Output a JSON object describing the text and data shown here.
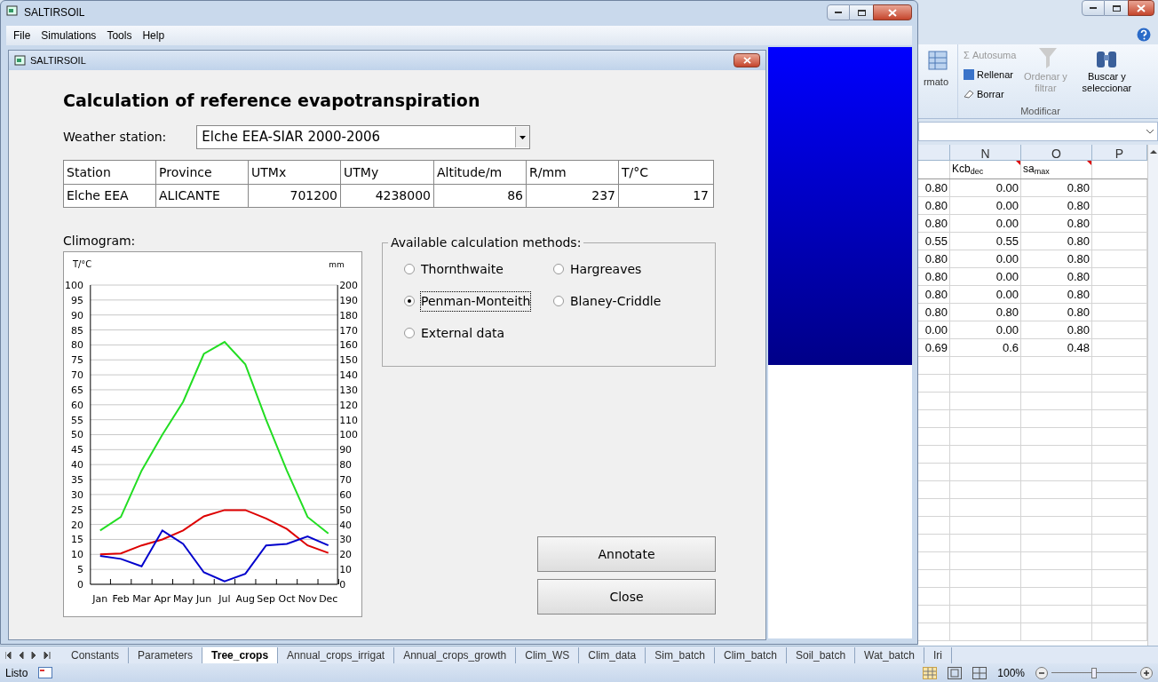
{
  "app_window": {
    "title": "SALTIRSOIL",
    "menu": [
      "File",
      "Simulations",
      "Tools",
      "Help"
    ]
  },
  "dialog": {
    "title": "SALTIRSOIL",
    "heading": "Calculation of reference evapotranspiration",
    "station_label": "Weather station:",
    "station_value": "Elche EEA-SIAR 2000-2006",
    "table": {
      "columns": [
        "Station",
        "Province",
        "UTMx",
        "UTMy",
        "Altitude/m",
        "R/mm",
        "T/°C"
      ],
      "rows": [
        [
          "Elche EEA",
          "ALICANTE",
          "701200",
          "4238000",
          "86",
          "237",
          "17"
        ]
      ]
    },
    "climogram_label": "Climogram:",
    "chart": {
      "chart_data": {
        "type": "line",
        "ylabel": "T/°C",
        "y2label": "mm",
        "categories": [
          "Jan",
          "Feb",
          "Mar",
          "Apr",
          "May",
          "Jun",
          "Jul",
          "Aug",
          "Sep",
          "Oct",
          "Nov",
          "Dec"
        ],
        "ylim": [
          0,
          100
        ],
        "grid": true,
        "yticks": [
          0,
          5,
          10,
          15,
          20,
          25,
          30,
          35,
          40,
          45,
          50,
          55,
          60,
          65,
          70,
          75,
          80,
          85,
          90,
          95,
          100
        ],
        "y2ticks": [
          "0",
          "10",
          "20",
          "30",
          "40",
          "50",
          "60",
          "70",
          "80",
          "90",
          "100",
          "110",
          "120",
          "130",
          "140",
          "150",
          "160",
          "170",
          "180",
          "190",
          "200"
        ],
        "series": [
          {
            "color": "#22dd22",
            "values": [
              18,
              22.5,
              38,
              50,
              61,
              77,
              81,
              73.5,
              55,
              38,
              22.5,
              17
            ]
          },
          {
            "color": "#dd0000",
            "values": [
              10,
              10.3,
              13,
              15,
              18,
              22.7,
              24.8,
              24.8,
              22,
              18.5,
              13,
              10.5
            ]
          },
          {
            "color": "#0000cc",
            "values": [
              9.5,
              8.5,
              6,
              18,
              13.5,
              4,
              1,
              3.5,
              13,
              13.5,
              16,
              13
            ]
          }
        ]
      }
    },
    "methods_title": "Available calculation methods:",
    "methods": [
      {
        "label": "Thornthwaite",
        "selected": false
      },
      {
        "label": "Hargreaves",
        "selected": false
      },
      {
        "label": "Penman-Monteith",
        "selected": true
      },
      {
        "label": "Blaney-Criddle",
        "selected": false
      },
      {
        "label": "External data",
        "selected": false
      }
    ],
    "buttons": [
      "Annotate",
      "Close"
    ]
  },
  "excel": {
    "ribbon": {
      "partial": "rmato",
      "autosuma_icon": "Σ",
      "autosuma": "Autosuma",
      "rellenar": "Rellenar",
      "borrar": "Borrar",
      "ordenar": "Ordenar y filtrar",
      "buscar": "Buscar y seleccionar",
      "group": "Modificar"
    },
    "columns": [
      "N",
      "O",
      "P"
    ],
    "header_row": [
      "Kcb$_{dec}$",
      "sa$_{max}$"
    ],
    "rows": [
      [
        "0.80",
        "0.00",
        "0.80"
      ],
      [
        "0.80",
        "0.00",
        "0.80"
      ],
      [
        "0.80",
        "0.00",
        "0.80"
      ],
      [
        "0.55",
        "0.55",
        "0.80"
      ],
      [
        "0.80",
        "0.00",
        "0.80"
      ],
      [
        "0.80",
        "0.00",
        "0.80"
      ],
      [
        "0.80",
        "0.00",
        "0.80"
      ],
      [
        "0.80",
        "0.80",
        "0.80"
      ],
      [
        "0.00",
        "0.00",
        "0.80"
      ],
      [
        "0.69",
        "0.6",
        "0.48"
      ]
    ],
    "sheets": [
      {
        "label": "Constants",
        "selected": false
      },
      {
        "label": "Parameters",
        "selected": false
      },
      {
        "label": "Tree_crops",
        "selected": true
      },
      {
        "label": "Annual_crops_irrigat",
        "selected": false
      },
      {
        "label": "Annual_crops_growth",
        "selected": false
      },
      {
        "label": "Clim_WS",
        "selected": false
      },
      {
        "label": "Clim_data",
        "selected": false
      },
      {
        "label": "Sim_batch",
        "selected": false
      },
      {
        "label": "Clim_batch",
        "selected": false
      },
      {
        "label": "Soil_batch",
        "selected": false
      },
      {
        "label": "Wat_batch",
        "selected": false
      },
      {
        "label": "Iri",
        "selected": false
      }
    ],
    "status": "Listo",
    "zoom": "100%",
    "zoom_slider": {
      "level": 0.5
    }
  }
}
